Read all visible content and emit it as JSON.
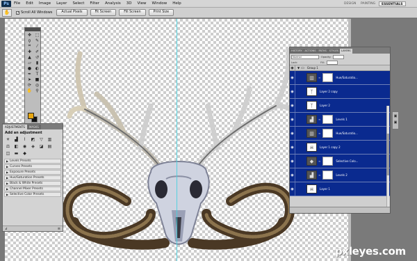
{
  "app": {
    "logo": "Ps"
  },
  "menu": [
    "File",
    "Edit",
    "Image",
    "Layer",
    "Select",
    "Filter",
    "Analysis",
    "3D",
    "View",
    "Window",
    "Help"
  ],
  "workspaces": {
    "design": "DESIGN",
    "painting": "PAINTING",
    "essentials": "ESSENTIALS"
  },
  "options": {
    "scroll_all_label": "Scroll All Windows",
    "buttons": [
      "Actual Pixels",
      "Fit Screen",
      "Fill Screen",
      "Print Size"
    ]
  },
  "adjustments": {
    "tabs": [
      "ADJUSTMENTS",
      "MASKS"
    ],
    "title": "Add an adjustment",
    "presets": [
      "Levels Presets",
      "Curves Presets",
      "Exposure Presets",
      "Hue/Saturation Presets",
      "Black & White Presets",
      "Channel Mixer Presets",
      "Selective Color Presets"
    ]
  },
  "layers": {
    "tabs": [
      "HISTORY",
      "ACTIONS",
      "PATHS",
      "STYLES",
      "LAYERS"
    ],
    "blend_mode": "Normal",
    "opacity_label": "Opacity:",
    "lock_label": "Lock:",
    "fill_label": "Fill:",
    "group": "Group 1",
    "rows": [
      {
        "name": "Hue/Saturatio...",
        "kind": "adjustment"
      },
      {
        "name": "Layer 2 copy",
        "kind": "image"
      },
      {
        "name": "Layer 2",
        "kind": "image"
      },
      {
        "name": "Levels 1",
        "kind": "adjustment"
      },
      {
        "name": "Hue/Saturatio...",
        "kind": "adjustment"
      },
      {
        "name": "Layer 1 copy 2",
        "kind": "image"
      },
      {
        "name": "Selective Colo...",
        "kind": "adjustment"
      },
      {
        "name": "Levels 2",
        "kind": "adjustment"
      },
      {
        "name": "Layer 1",
        "kind": "image"
      }
    ]
  },
  "colors": {
    "foreground": "#e8a711",
    "background": "#111111",
    "layer_highlight": "#0a2a8f",
    "guide": "#46d2e0"
  },
  "watermark": "pxleyes.com"
}
